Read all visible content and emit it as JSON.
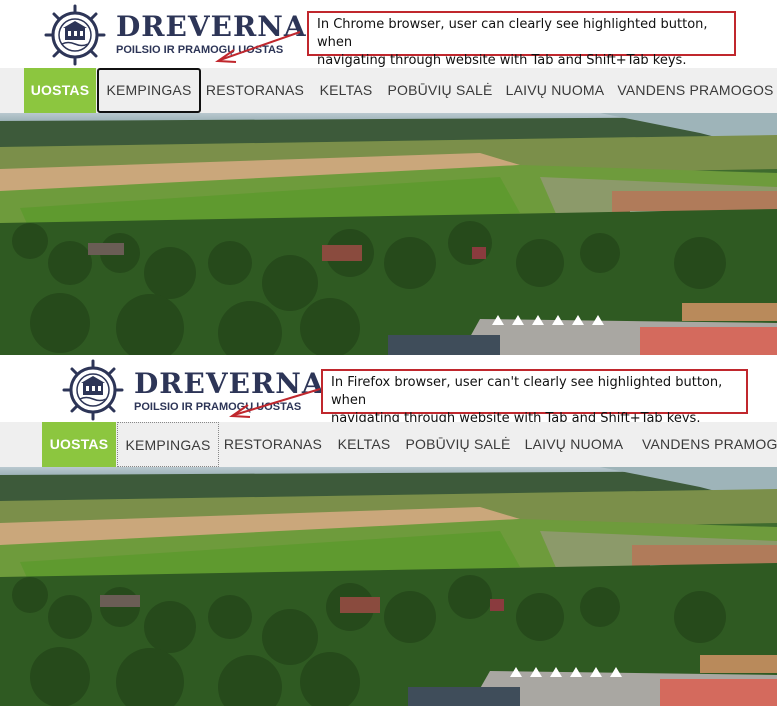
{
  "panels": [
    {
      "id": "chrome",
      "logo": {
        "brand": "DREVERNA",
        "tagline": "POILSIO IR PRAMOGŲ UOSTAS"
      },
      "callout": {
        "line1": "In Chrome browser, user can clearly see highlighted button, when",
        "line2": "navigating through website with Tab and Shift+Tab keys."
      },
      "nav": [
        {
          "label": "UOSTAS",
          "state": "active"
        },
        {
          "label": "KEMPINGAS",
          "state": "focused"
        },
        {
          "label": "RESTORANAS",
          "state": "normal"
        },
        {
          "label": "KELTAS",
          "state": "normal"
        },
        {
          "label": "POBŪVIŲ SALĖ",
          "state": "normal"
        },
        {
          "label": "LAIVŲ NUOMA",
          "state": "normal"
        },
        {
          "label": "VANDENS PRAMOGOS",
          "state": "normal"
        }
      ]
    },
    {
      "id": "firefox",
      "logo": {
        "brand": "DREVERNA",
        "tagline": "POILSIO IR PRAMOGŲ UOSTAS"
      },
      "callout": {
        "line1": "In Firefox browser, user can't clearly see highlighted button, when",
        "line2": "navigating through website with Tab and Shift+Tab keys."
      },
      "nav": [
        {
          "label": "UOSTAS",
          "state": "active"
        },
        {
          "label": "KEMPINGAS",
          "state": "focused"
        },
        {
          "label": "RESTORANAS",
          "state": "normal"
        },
        {
          "label": "KELTAS",
          "state": "normal"
        },
        {
          "label": "POBŪVIŲ SALĖ",
          "state": "normal"
        },
        {
          "label": "LAIVŲ NUOMA",
          "state": "normal"
        },
        {
          "label": "VANDENS PRAMOGOS",
          "state": "normal"
        }
      ]
    }
  ],
  "colors": {
    "active_nav": "#8cc63f",
    "navbar_bg": "#efefef",
    "brand_navy": "#2d3557",
    "callout_border": "#c0272d"
  }
}
